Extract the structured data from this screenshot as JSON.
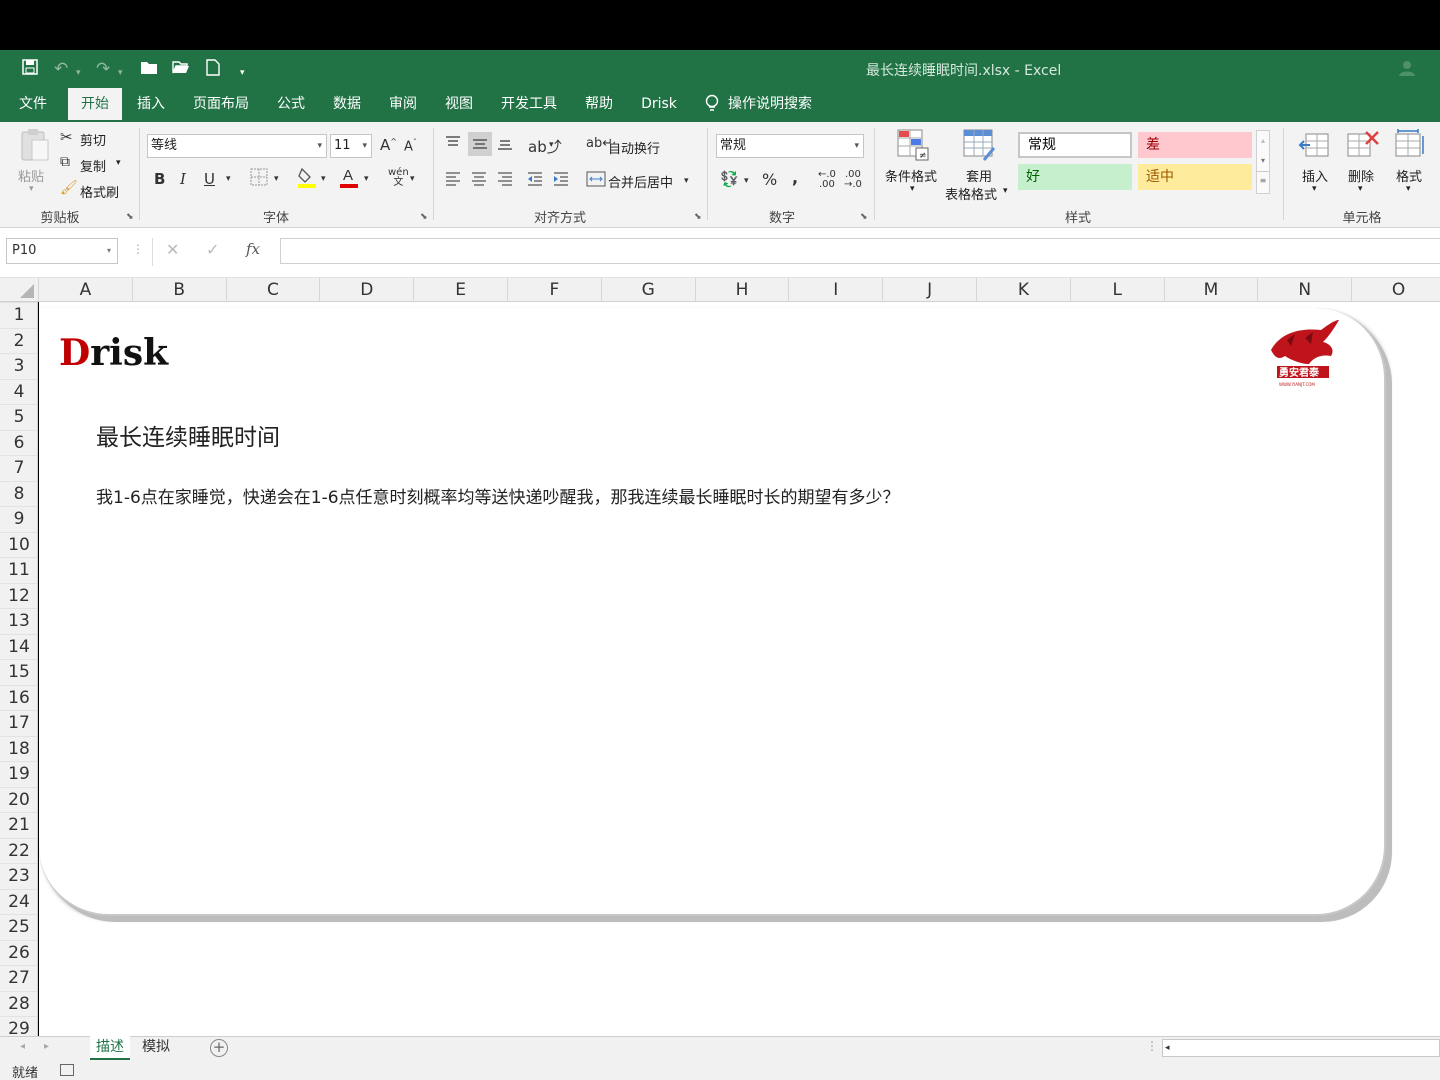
{
  "window": {
    "title": "最长连续睡眠时间.xlsx  -  Excel"
  },
  "qat": {
    "icons": [
      "save-icon",
      "undo-icon",
      "redo-icon",
      "new-folder-icon",
      "open-folder-icon",
      "new-file-icon",
      "customize-qat-icon"
    ]
  },
  "tabs": [
    {
      "label": "文件"
    },
    {
      "label": "开始"
    },
    {
      "label": "插入"
    },
    {
      "label": "页面布局"
    },
    {
      "label": "公式"
    },
    {
      "label": "数据"
    },
    {
      "label": "审阅"
    },
    {
      "label": "视图"
    },
    {
      "label": "开发工具"
    },
    {
      "label": "帮助"
    },
    {
      "label": "Drisk"
    }
  ],
  "tell_me": "操作说明搜索",
  "ribbon": {
    "clipboard": {
      "label": "剪贴板",
      "paste": "粘贴",
      "cut": "剪切",
      "copy": "复制",
      "format_painter": "格式刷"
    },
    "font": {
      "label": "字体",
      "font_name": "等线",
      "font_size": "11"
    },
    "alignment": {
      "label": "对齐方式",
      "wrap_text": "自动换行",
      "merge_center": "合并后居中"
    },
    "number": {
      "label": "数字",
      "format": "常规"
    },
    "styles": {
      "label": "样式",
      "conditional_format": "条件格式",
      "table_format_line1": "套用",
      "table_format_line2": "表格格式",
      "cells": [
        {
          "text": "常规",
          "bg": "#ffffff",
          "fg": "#000000"
        },
        {
          "text": "差",
          "bg": "#ffc7ce",
          "fg": "#9c0006"
        },
        {
          "text": "好",
          "bg": "#c6efce",
          "fg": "#006100"
        },
        {
          "text": "适中",
          "bg": "#ffeb9c",
          "fg": "#9c5700"
        }
      ]
    },
    "cells": {
      "label": "单元格",
      "insert": "插入",
      "delete": "删除",
      "format": "格式"
    }
  },
  "formula_bar": {
    "name_box": "P10",
    "fx": "fx",
    "value": ""
  },
  "columns": [
    "A",
    "B",
    "C",
    "D",
    "E",
    "F",
    "G",
    "H",
    "I",
    "J",
    "K",
    "L",
    "M",
    "N",
    "O"
  ],
  "rows": [
    "1",
    "2",
    "3",
    "4",
    "5",
    "6",
    "7",
    "8",
    "9",
    "10",
    "11",
    "12",
    "13",
    "14",
    "15",
    "16",
    "17",
    "18",
    "19",
    "20",
    "21",
    "22",
    "23",
    "24",
    "25",
    "26",
    "27",
    "28",
    "29"
  ],
  "sheet": {
    "logo_rest": "risk",
    "logo_first": "D",
    "title": "最长连续睡眠时间",
    "question": "我1-6点在家睡觉，快递会在1-6点任意时刻概率均等送快递吵醒我，那我连续最长睡眠时长的期望有多少？",
    "seal_text": "勇安君泰",
    "seal_sub": "WWW.YIANJT.COM"
  },
  "sheet_tabs": [
    {
      "label": "描述",
      "active": true
    },
    {
      "label": "模拟",
      "active": false
    }
  ],
  "status": {
    "ready": "就绪"
  },
  "colors": {
    "excel_green": "#217346",
    "logo_red": "#c00000"
  }
}
